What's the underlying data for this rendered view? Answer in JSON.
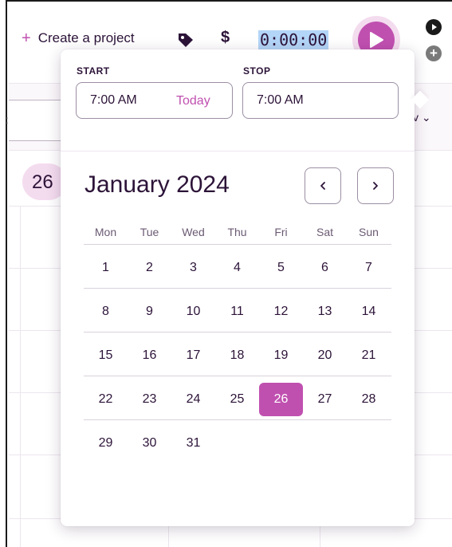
{
  "topbar": {
    "create_project_plus": "+",
    "create_project_label": "Create a project",
    "tag_icon": "tag-icon",
    "dollar_symbol": "$",
    "timer": "0:00:00",
    "play_icon": "play-icon",
    "mini_plus_symbol": "+"
  },
  "background": {
    "date_pill": "26",
    "view_fragment": "v ⌄",
    "d_fragment": "ɔ"
  },
  "popover": {
    "start_label": "START",
    "stop_label": "STOP",
    "start_time": "7:00 AM",
    "today_link": "Today",
    "stop_time": "7:00 AM",
    "month_title": "January 2024",
    "prev_symbol": "‹",
    "next_symbol": "›",
    "weekdays": [
      "Mon",
      "Tue",
      "Wed",
      "Thu",
      "Fri",
      "Sat",
      "Sun"
    ],
    "weeks": [
      [
        "1",
        "2",
        "3",
        "4",
        "5",
        "6",
        "7"
      ],
      [
        "8",
        "9",
        "10",
        "11",
        "12",
        "13",
        "14"
      ],
      [
        "15",
        "16",
        "17",
        "18",
        "19",
        "20",
        "21"
      ],
      [
        "22",
        "23",
        "24",
        "25",
        "26",
        "27",
        "28"
      ],
      [
        "29",
        "30",
        "31",
        "",
        "",
        "",
        ""
      ]
    ],
    "selected_day": "26"
  },
  "colors": {
    "accent": "#c050b0",
    "accent_light": "#f4dcef",
    "text": "#2c1338",
    "timer_highlight": "#b3d5f7"
  }
}
